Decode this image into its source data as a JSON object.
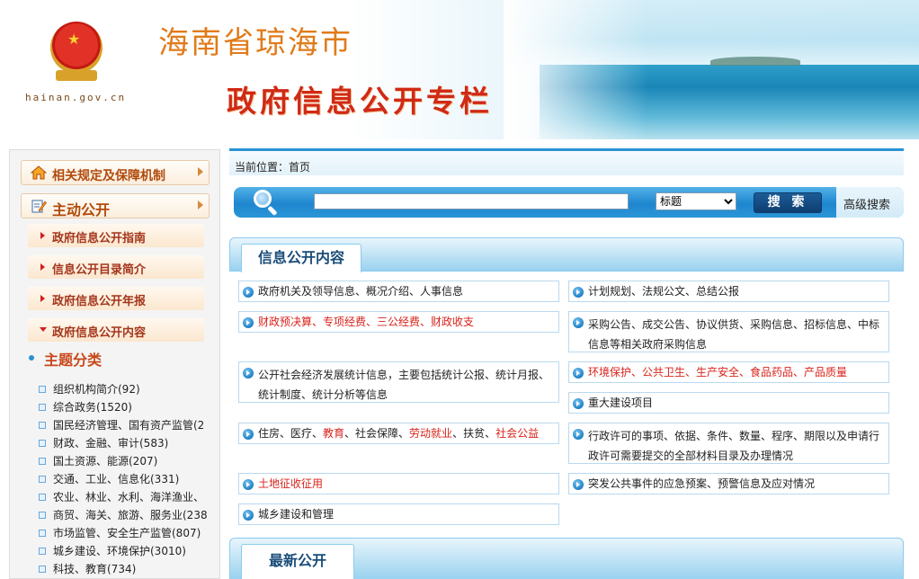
{
  "header": {
    "city_title": "海南省琼海市",
    "column_title": "政府信息公开专栏",
    "site_domain": "hainan.gov.cn"
  },
  "sidebar": {
    "sections": [
      {
        "label": "相关规定及保障机制",
        "icon": "house-icon"
      },
      {
        "label": "主动公开",
        "icon": "pen-document-icon"
      }
    ],
    "sub_items": [
      {
        "label": "政府信息公开指南",
        "expanded": false
      },
      {
        "label": "信息公开目录简介",
        "expanded": false
      },
      {
        "label": "政府信息公开年报",
        "expanded": false
      },
      {
        "label": "政府信息公开内容",
        "expanded": true
      }
    ],
    "topic_heading": "主题分类",
    "topics": [
      "组织机构简介(92)",
      "综合政务(1520)",
      "国民经济管理、国有资产监管(2",
      "财政、金融、审计(583)",
      "国土资源、能源(207)",
      "交通、工业、信息化(331)",
      "农业、林业、水利、海洋渔业、",
      "商贸、海关、旅游、服务业(238",
      "市场监管、安全生产监管(807)",
      "城乡建设、环境保护(3010)",
      "科技、教育(734)"
    ]
  },
  "breadcrumb": {
    "label": "当前位置：",
    "current": "首页"
  },
  "search": {
    "placeholder": "",
    "select_value": "标题",
    "button_label": "搜 索",
    "advanced_label": "高级搜索"
  },
  "sections": {
    "info_content": "信息公开内容",
    "latest": "最新公开"
  },
  "categories": {
    "c1": "政府机关及领导信息、概况介绍、人事信息",
    "c2": "计划规划、法规公文、总结公报",
    "c3": "财政预决算、专项经费、三公经费、财政收支",
    "c4": "采购公告、成交公告、协议供货、采购信息、招标信息、中标信息等相关政府采购信息",
    "c5": "公开社会经济发展统计信息，主要包括统计公报、统计月报、统计制度、统计分析等信息",
    "c6": "环境保护、公共卫生、生产安全、食品药品、产品质量",
    "c7": "重大建设项目",
    "c8_p1": "住房、医疗、",
    "c8_p2": "教育",
    "c8_p3": "、社会保障、",
    "c8_p4": "劳动就业",
    "c8_p5": "、扶贫、",
    "c8_p6": "社会公益",
    "c9": "行政许可的事项、依据、条件、数量、程序、期限以及申请行政许可需要提交的全部材料目录及办理情况",
    "c10": "土地征收征用",
    "c11": "突发公共事件的应急预案、预警信息及应对情况",
    "c12": "城乡建设和管理"
  },
  "colors": {
    "accent_blue": "#1e86cf",
    "highlight_red": "#d8231c",
    "sidebar_heading": "#b14a0c"
  }
}
